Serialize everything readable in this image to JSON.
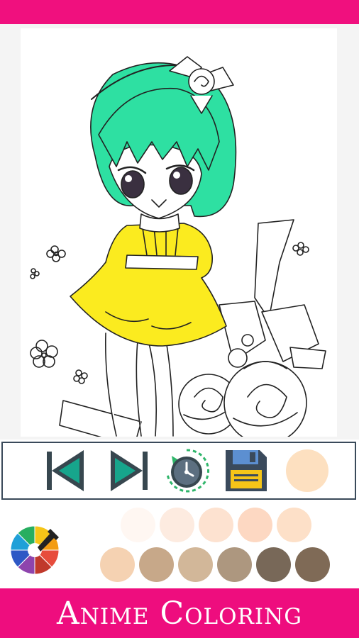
{
  "app": {
    "title": "Anime Coloring"
  },
  "colors": {
    "brand": "#f0107e",
    "hair_fill": "#2ee0a2",
    "dress_fill": "#fbeb1f",
    "current_color": "#fde0c0"
  },
  "toolbar": {
    "items": [
      {
        "name": "previous-image-button",
        "icon": "skip-previous-icon"
      },
      {
        "name": "next-image-button",
        "icon": "skip-next-icon"
      },
      {
        "name": "history-button",
        "icon": "history-clock-icon"
      },
      {
        "name": "save-button",
        "icon": "floppy-disk-icon"
      },
      {
        "name": "current-color-indicator",
        "icon": "color-dot"
      }
    ]
  },
  "palette": {
    "picker_icon": "color-wheel-picker-icon",
    "rows": [
      [
        "#fff7f2",
        "#fdebe0",
        "#fde2d0",
        "#fdd8c2",
        "#fde0c8"
      ],
      [
        "#f5d2b2",
        "#c7a889",
        "#d2b799",
        "#ad977f",
        "#786858",
        "#7f6a56"
      ]
    ]
  }
}
